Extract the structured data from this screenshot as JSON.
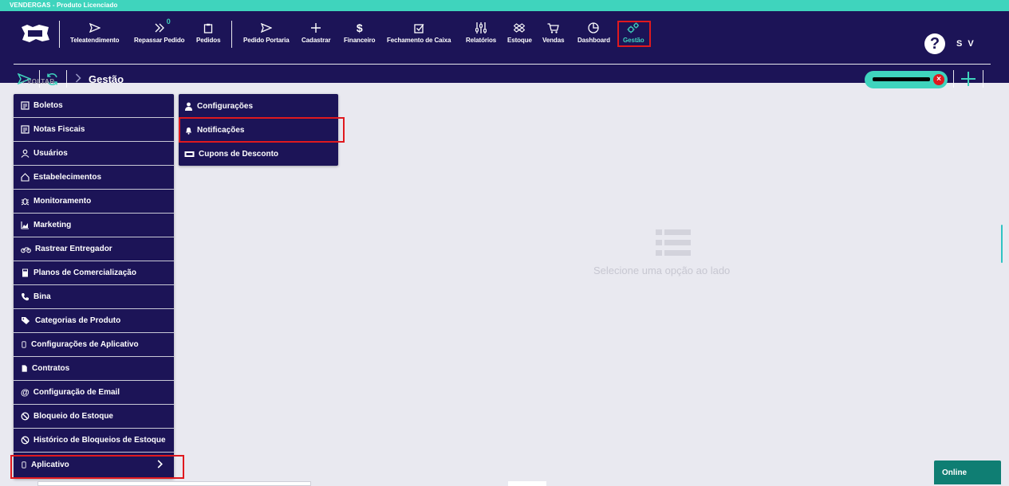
{
  "app": {
    "title": "VENDERGAS - Produto Licenciado"
  },
  "nav": {
    "items": [
      {
        "label": "Teleatendimento",
        "icon": "send-icon"
      },
      {
        "label": "Repassar Pedido",
        "icon": "double-chevron-right-icon",
        "badge": "0"
      },
      {
        "label": "Pedidos",
        "icon": "clipboard-icon"
      },
      {
        "label": "Pedido Portaria",
        "icon": "send-icon"
      },
      {
        "label": "Cadastrar",
        "icon": "plus-icon"
      },
      {
        "label": "Financeiro",
        "icon": "dollar-icon"
      },
      {
        "label": "Fechamento de Caixa",
        "icon": "checkbox-icon"
      },
      {
        "label": "Relatórios",
        "icon": "sliders-icon"
      },
      {
        "label": "Estoque",
        "icon": "dropbox-icon"
      },
      {
        "label": "Vendas",
        "icon": "cart-icon"
      },
      {
        "label": "Dashboard",
        "icon": "pie-chart-icon"
      },
      {
        "label": "Gestão",
        "icon": "gears-icon",
        "active": true
      }
    ],
    "help_label": "?",
    "user_initials": "S V"
  },
  "subheader": {
    "breadcrumb": "Gestão",
    "back_label": "VOLTAR"
  },
  "sidebar": {
    "items": [
      {
        "label": "Boletos",
        "icon": "receipt-icon"
      },
      {
        "label": "Notas Fiscais",
        "icon": "receipt-icon"
      },
      {
        "label": "Usuários",
        "icon": "users-icon"
      },
      {
        "label": "Estabelecimentos",
        "icon": "home-icon"
      },
      {
        "label": "Monitoramento",
        "icon": "bug-icon"
      },
      {
        "label": "Marketing",
        "icon": "area-chart-icon"
      },
      {
        "label": "Rastrear Entregador",
        "icon": "motorcycle-icon"
      },
      {
        "label": "Planos de Comercialização",
        "icon": "calculator-icon"
      },
      {
        "label": "Bina",
        "icon": "phone-icon"
      },
      {
        "label": "Categorias de Produto",
        "icon": "tags-icon"
      },
      {
        "label": "Configurações de Aplicativo",
        "icon": "mobile-icon"
      },
      {
        "label": "Contratos",
        "icon": "file-icon"
      },
      {
        "label": "Configuração de Email",
        "icon": "at-icon"
      },
      {
        "label": "Bloqueio do Estoque",
        "icon": "ban-icon"
      },
      {
        "label": "Histórico de Bloqueios de Estoque",
        "icon": "ban-icon"
      },
      {
        "label": "Aplicativo",
        "icon": "mobile-icon",
        "has_submenu": true
      }
    ]
  },
  "submenu": {
    "items": [
      {
        "label": "Configurações",
        "icon": "user-icon"
      },
      {
        "label": "Notificações",
        "icon": "bell-icon"
      },
      {
        "label": "Cupons de Desconto",
        "icon": "ticket-icon"
      }
    ]
  },
  "main": {
    "empty_icon": "list-icon",
    "empty_message": "Selecione uma opção ao lado"
  },
  "status": {
    "online_label": "Online"
  },
  "colors": {
    "brand_dark": "#1c1457",
    "accent_teal": "#3fd4bd",
    "highlight_red": "#e0191e"
  }
}
